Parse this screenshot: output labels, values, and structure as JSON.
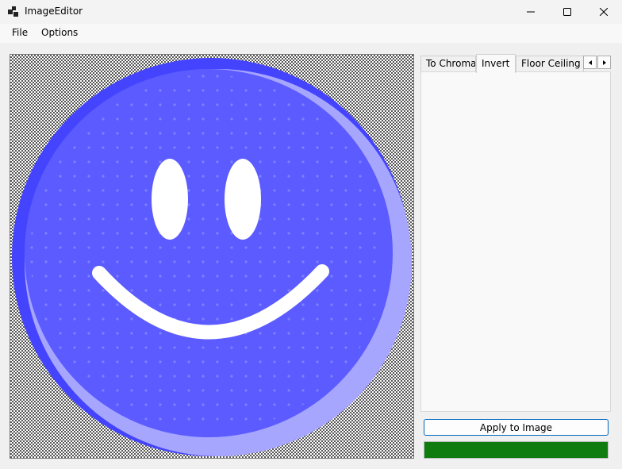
{
  "window": {
    "title": "ImageEditor"
  },
  "menu": {
    "file": "File",
    "options": "Options"
  },
  "tabs": [
    {
      "label": "To Chroma"
    },
    {
      "label": "Invert"
    },
    {
      "label": "Floor Ceiling Lu"
    }
  ],
  "active_tab": "Invert",
  "apply_button": {
    "label": "Apply to Image"
  },
  "progress": {
    "value": 100,
    "color": "#107c10"
  },
  "colors": {
    "smiley_face": "#5b5bff",
    "smiley_dark": "#4040ff",
    "smiley_light": "#a0a0ff",
    "features": "#ffffff",
    "accent": "#0067c0"
  },
  "icons": {
    "app": "app-icon",
    "minimize": "minimize-icon",
    "maximize": "maximize-icon",
    "close": "close-icon",
    "tab_left": "chevron-left-icon",
    "tab_right": "chevron-right-icon"
  }
}
